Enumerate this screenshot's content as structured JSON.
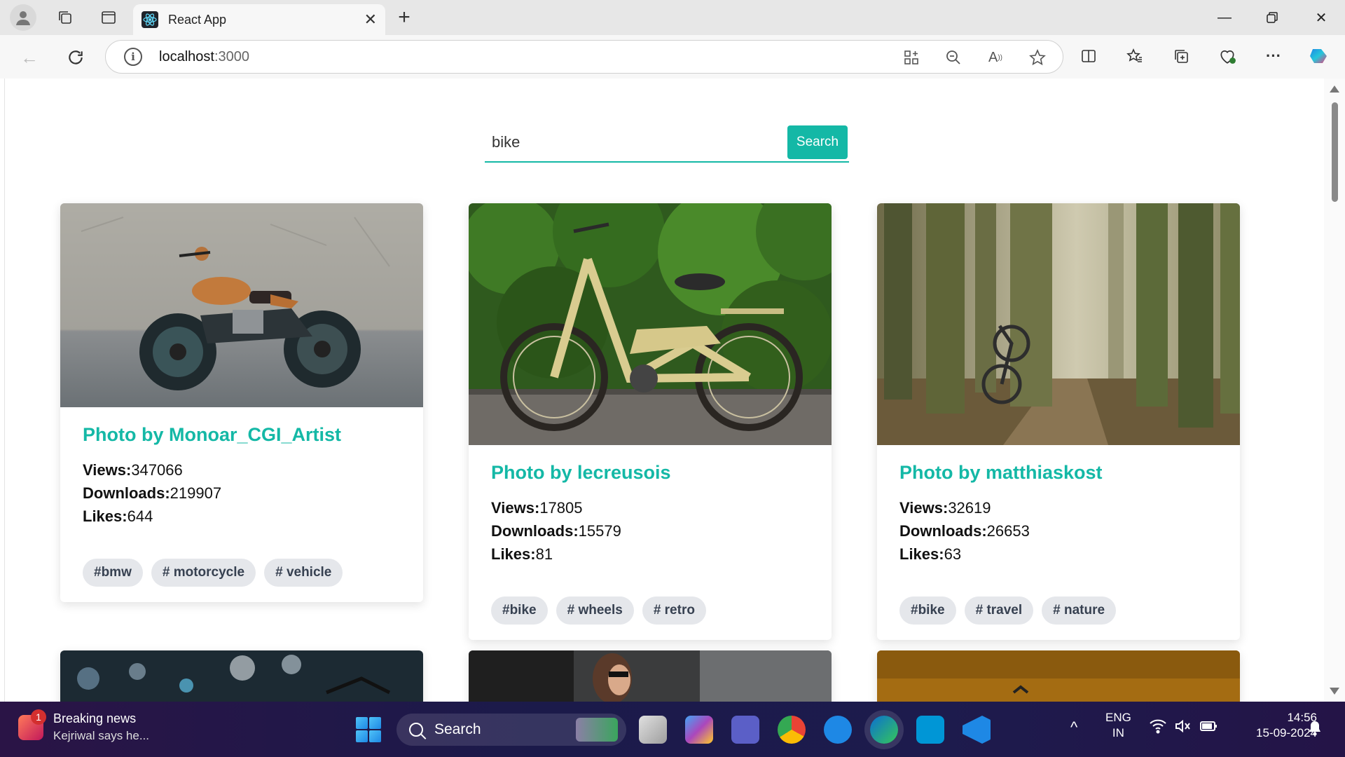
{
  "browser": {
    "tab_title": "React App",
    "address_host": "localhost",
    "address_port": ":3000"
  },
  "search": {
    "value": "bike",
    "button_label": "Search"
  },
  "cards": [
    {
      "title": "Photo by Monoar_CGI_Artist",
      "views_label": "Views:",
      "views": "347066",
      "downloads_label": "Downloads:",
      "downloads": "219907",
      "likes_label": "Likes:",
      "likes": "644",
      "tags": [
        "#bmw",
        "# motorcycle",
        "# vehicle"
      ]
    },
    {
      "title": "Photo by lecreusois",
      "views_label": "Views:",
      "views": "17805",
      "downloads_label": "Downloads:",
      "downloads": "15579",
      "likes_label": "Likes:",
      "likes": "81",
      "tags": [
        "#bike",
        "# wheels",
        "# retro"
      ]
    },
    {
      "title": "Photo by matthiaskost",
      "views_label": "Views:",
      "views": "32619",
      "downloads_label": "Downloads:",
      "downloads": "26653",
      "likes_label": "Likes:",
      "likes": "63",
      "tags": [
        "#bike",
        "# travel",
        "# nature"
      ]
    }
  ],
  "taskbar": {
    "news_badge": "1",
    "news_title": "Breaking news",
    "news_subtitle": "Kejriwal says he...",
    "search_label": "Search",
    "lang_line1": "ENG",
    "lang_line2": "IN",
    "time": "14:56",
    "date": "15-09-2024"
  },
  "colors": {
    "accent": "#14b8a6",
    "tag_bg": "#e5e7eb"
  }
}
